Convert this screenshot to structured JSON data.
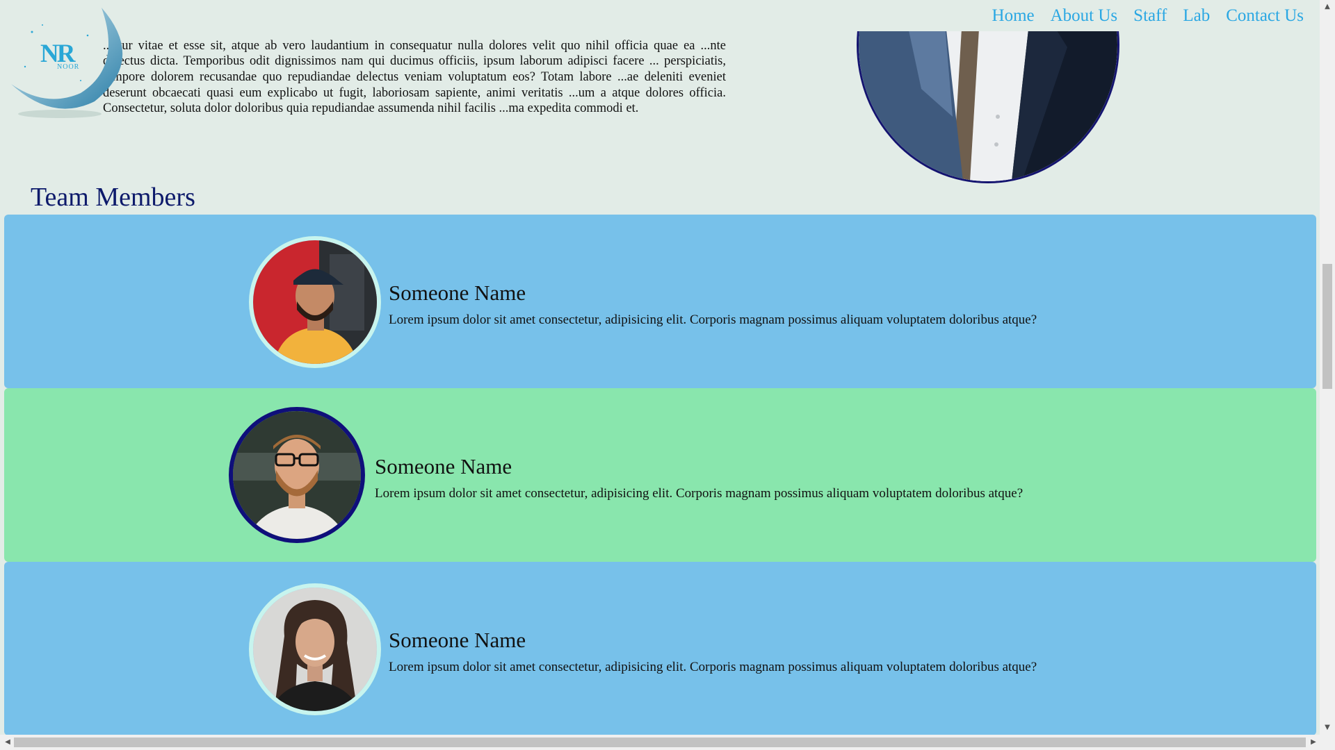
{
  "nav": {
    "items": [
      {
        "label": "Home"
      },
      {
        "label": "About Us"
      },
      {
        "label": "Staff"
      },
      {
        "label": "Lab"
      },
      {
        "label": "Contact Us"
      }
    ]
  },
  "logo": {
    "text": "NR",
    "subtext": "NOOR"
  },
  "intro": {
    "paragraph": "...etur vitae et esse sit, atque ab vero laudantium in consequatur nulla dolores velit quo nihil officia quae ea ...nte delectus dicta. Temporibus odit dignissimos nam qui ducimus officiis, ipsum laborum adipisci facere ... perspiciatis, tempore dolorem recusandae quo repudiandae delectus veniam voluptatum eos? Totam labore ...ae deleniti eveniet deserunt obcaecati quasi eum explicabo ut fugit, laboriosam sapiente, animi veritatis ...um a atque dolores officia. Consectetur, soluta dolor doloribus quia repudiandae assumenda nihil facilis ...ma expedita commodi et."
  },
  "team": {
    "title": "Team Members",
    "members": [
      {
        "name": "Someone Name",
        "bio": "Lorem ipsum dolor sit amet consectetur, adipisicing elit. Corporis magnam possimus aliquam voluptatem doloribus atque?"
      },
      {
        "name": "Someone Name",
        "bio": "Lorem ipsum dolor sit amet consectetur, adipisicing elit. Corporis magnam possimus aliquam voluptatem doloribus atque?"
      },
      {
        "name": "Someone Name",
        "bio": "Lorem ipsum dolor sit amet consectetur, adipisicing elit. Corporis magnam possimus aliquam voluptatem doloribus atque?"
      }
    ]
  },
  "scrollbar": {
    "up": "▲",
    "down": "▼",
    "left": "◀",
    "right": "▶"
  },
  "colors": {
    "page_bg": "#e2ece7",
    "nav_link": "#2aa7e3",
    "card_blue": "#77c1ea",
    "card_green": "#89e6ad",
    "heading": "#0d1a6b"
  }
}
